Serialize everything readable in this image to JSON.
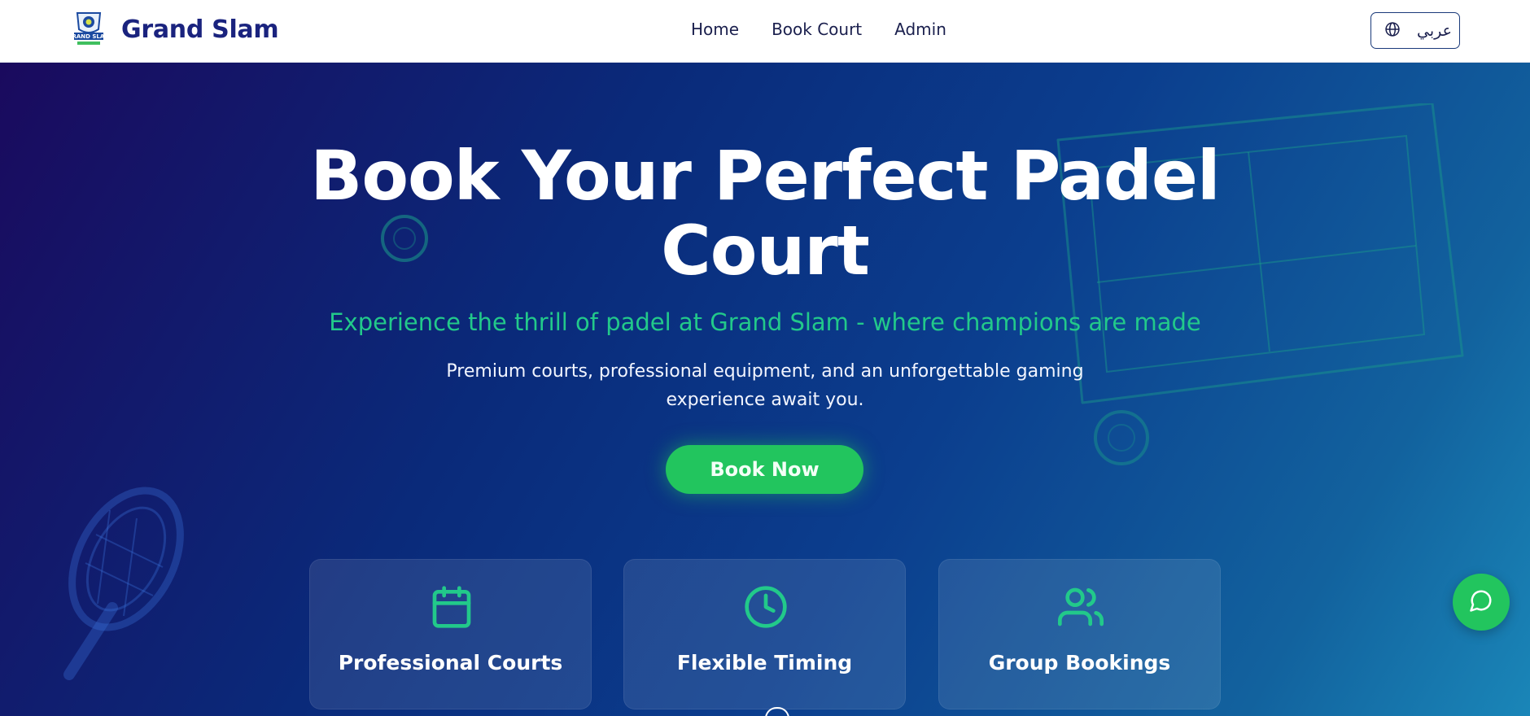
{
  "brand": {
    "name": "Grand Slam",
    "logo_icon": "grand-slam-logo-icon",
    "logo_text": "GRAND SLAM"
  },
  "nav": {
    "items": [
      {
        "label": "Home"
      },
      {
        "label": "Book Court"
      },
      {
        "label": "Admin"
      }
    ]
  },
  "language_toggle": {
    "label": "عربي",
    "icon": "globe-icon"
  },
  "hero": {
    "title": "Book Your Perfect Padel Court",
    "subtitle": "Experience the thrill of padel at Grand Slam - where champions are made",
    "description": "Premium courts, professional equipment, and an unforgettable gaming experience await you.",
    "cta_label": "Book Now"
  },
  "features": [
    {
      "title": "Professional Courts",
      "icon": "calendar-icon"
    },
    {
      "title": "Flexible Timing",
      "icon": "clock-icon"
    },
    {
      "title": "Group Bookings",
      "icon": "users-icon"
    }
  ],
  "chat": {
    "icon": "chat-bubble-icon"
  },
  "colors": {
    "brand_navy": "#1a237e",
    "accent_green": "#22c55e",
    "subtitle_green": "#22c98a",
    "hero_gradient_start": "#1a0a5e",
    "hero_gradient_end": "#1a86b8"
  }
}
